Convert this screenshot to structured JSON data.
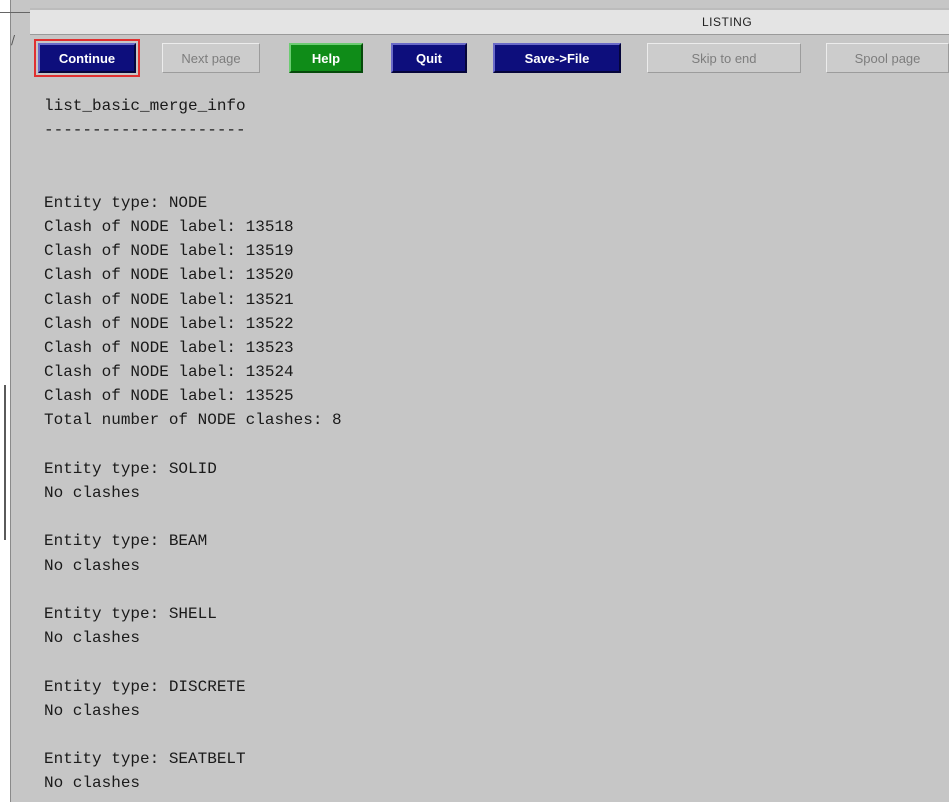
{
  "window": {
    "title": "LISTING"
  },
  "toolbar": {
    "buttons": [
      {
        "label": "Continue",
        "state": "active",
        "color": "#0d0e7c"
      },
      {
        "label": "Next page",
        "state": "disabled"
      },
      {
        "label": "Help",
        "state": "active",
        "color": "#0f8c18"
      },
      {
        "label": "Quit",
        "state": "active",
        "color": "#0d0e7c"
      },
      {
        "label": "Save->File",
        "state": "active",
        "color": "#0d0e7c"
      },
      {
        "label": "Skip to end",
        "state": "disabled"
      },
      {
        "label": "Spool page",
        "state": "disabled"
      }
    ],
    "focus_color": "#e03030"
  },
  "listing": {
    "lines": [
      "list_basic_merge_info",
      "---------------------",
      "",
      "",
      "Entity type: NODE",
      "Clash of NODE label: 13518",
      "Clash of NODE label: 13519",
      "Clash of NODE label: 13520",
      "Clash of NODE label: 13521",
      "Clash of NODE label: 13522",
      "Clash of NODE label: 13523",
      "Clash of NODE label: 13524",
      "Clash of NODE label: 13525",
      "Total number of NODE clashes: 8",
      "",
      "Entity type: SOLID",
      "No clashes",
      "",
      "Entity type: BEAM",
      "No clashes",
      "",
      "Entity type: SHELL",
      "No clashes",
      "",
      "Entity type: DISCRETE",
      "No clashes",
      "",
      "Entity type: SEATBELT",
      "No clashes"
    ]
  }
}
